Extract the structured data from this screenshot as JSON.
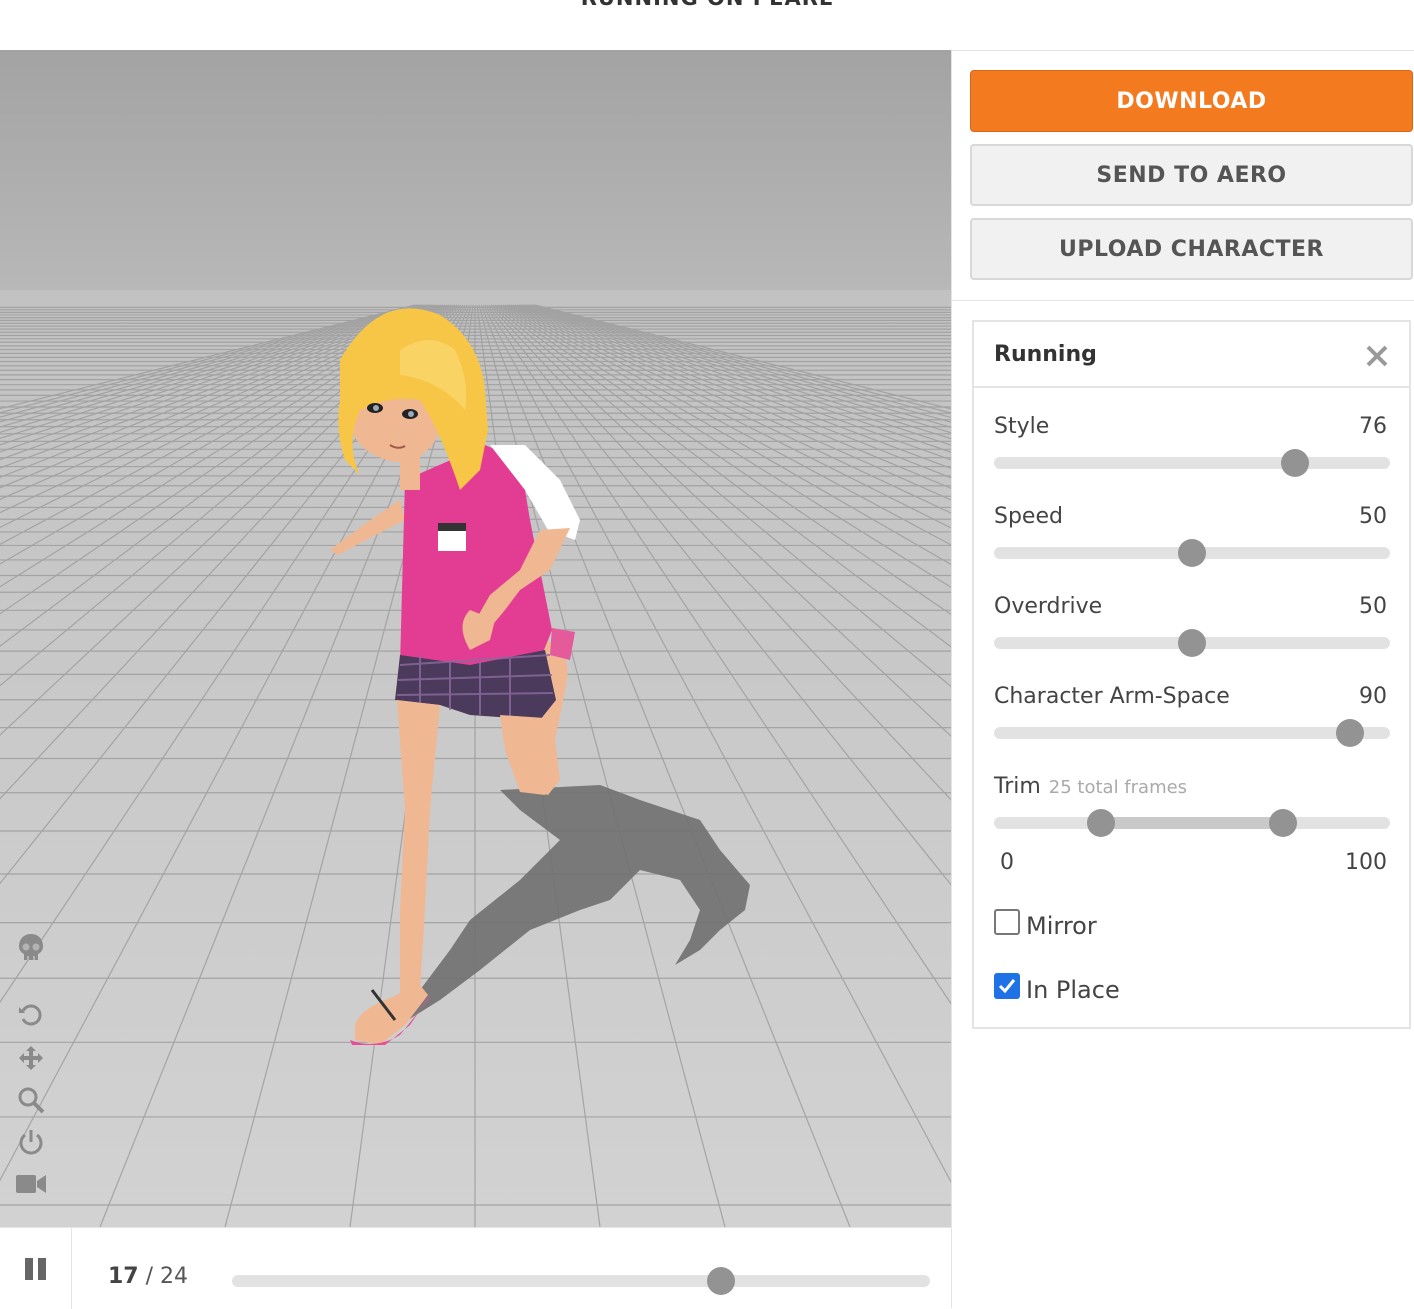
{
  "header": {
    "title": "RUNNING ON PEARL"
  },
  "actions": {
    "download_label": "DOWNLOAD",
    "send_label": "SEND TO AERO",
    "upload_label": "UPLOAD CHARACTER"
  },
  "panel": {
    "title": "Running",
    "params": [
      {
        "label": "Style",
        "value": "76",
        "level": 0.76
      },
      {
        "label": "Speed",
        "value": "50",
        "level": 0.5
      },
      {
        "label": "Overdrive",
        "value": "50",
        "level": 0.5
      },
      {
        "label": "Character Arm-Space",
        "value": "90",
        "level": 0.9
      }
    ],
    "trim": {
      "label": "Trim",
      "sub_label": "25 total frames",
      "min_label": "0",
      "max_label": "100",
      "start": 0.27,
      "end": 0.73
    },
    "mirror": {
      "label": "Mirror",
      "checked": false
    },
    "in_place": {
      "label": "In Place",
      "checked": true
    }
  },
  "playback": {
    "current_frame": "17",
    "separator": "/",
    "total_frames": "24",
    "progress": 0.7
  },
  "icons": {
    "skeleton": "skull-icon",
    "reset": "reset-icon",
    "pan": "move-icon",
    "zoom": "search-icon",
    "power": "power-icon",
    "camera": "video-camera-icon",
    "pause": "pause-icon",
    "close": "close-icon"
  },
  "colors": {
    "accent": "#f47a20",
    "checkbox": "#1f72e6",
    "knob": "#939393"
  }
}
